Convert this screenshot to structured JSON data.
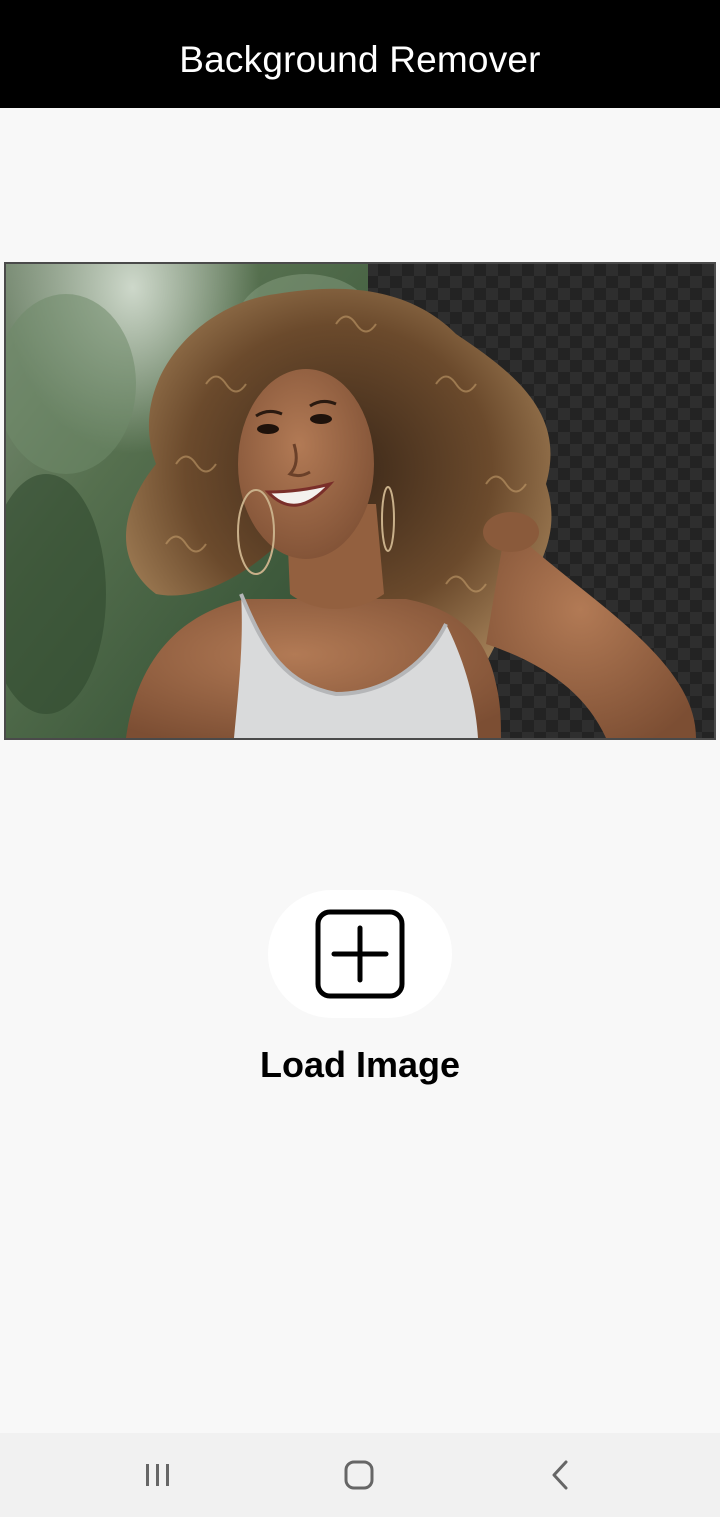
{
  "app_bar": {
    "title": "Background Remover"
  },
  "preview": {
    "image_name": "woman-curly-hair-background-removed",
    "left_side": "original-background",
    "right_side": "transparent-checkerboard"
  },
  "load": {
    "icon": "add-square-icon",
    "label": "Load Image"
  },
  "nav": {
    "recent_icon": "recent-apps-icon",
    "home_icon": "home-icon",
    "back_icon": "back-icon"
  },
  "colors": {
    "app_bar": "#000000",
    "background": "#f8f8f8",
    "nav_bar": "#f1f1f1",
    "checker_dark": "#232323",
    "checker_light": "#2e2e2e"
  }
}
